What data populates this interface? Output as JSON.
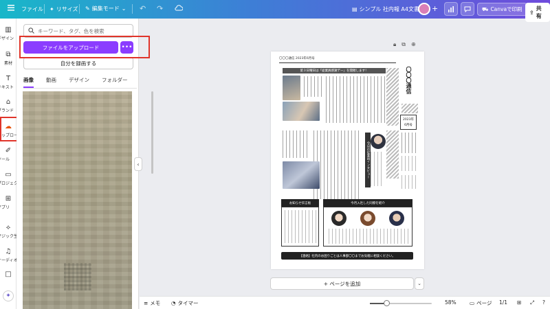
{
  "topbar": {
    "file_label": "ファイル",
    "resize_label": "リサイズ",
    "edit_mode_label": "編集モード",
    "doc_title": "シンプル 社内報 A4文書",
    "print_label": "Canvaで印刷",
    "share_label": "共有"
  },
  "rail": {
    "items": [
      {
        "label": "デザイン",
        "icon": "layout-icon"
      },
      {
        "label": "素材",
        "icon": "shapes-icon"
      },
      {
        "label": "テキスト",
        "icon": "text-icon"
      },
      {
        "label": "ブランド",
        "icon": "brand-icon"
      },
      {
        "label": "アップロード",
        "icon": "upload-cloud-icon"
      },
      {
        "label": "ツール",
        "icon": "pen-icon"
      },
      {
        "label": "プロジェクト",
        "icon": "folder-icon"
      },
      {
        "label": "アプリ",
        "icon": "apps-icon"
      },
      {
        "label": "マジック生成",
        "icon": "magic-icon"
      },
      {
        "label": "オーディオ",
        "icon": "music-icon"
      }
    ]
  },
  "panel": {
    "search_placeholder": "キーワード、タグ、色を検索",
    "upload_label": "ファイルをアップロード",
    "more_label": "•••",
    "record_label": "自分を録画する",
    "tabs": [
      "画像",
      "動画",
      "デザイン",
      "フォルダー"
    ],
    "active_tab": "画像"
  },
  "doc": {
    "header": "〇〇〇通信 2023年6月号",
    "banner": "第３日曜日は「従業員感謝デー」を開催します！",
    "title": "〇〇〇通信",
    "date_year": "2023年",
    "date_month": "6月号",
    "interview": "今月の従業員インタビュー",
    "notice": "お知らせ伝言板",
    "newcomers": "今月入社した同僚を紹介",
    "footer": "【連絡】社内のお困りごとは人事部〇〇までお気軽に相談ください。"
  },
  "canvas": {
    "add_page_label": "+ ページを追加"
  },
  "bottombar": {
    "memo_label": "メモ",
    "timer_label": "タイマー",
    "zoom": "58%",
    "page_label": "ページ",
    "page_count": "1/1"
  },
  "colors": {
    "accent": "#8b3dff",
    "highlight": "#e0342a",
    "active_rail": "#e8540c"
  }
}
